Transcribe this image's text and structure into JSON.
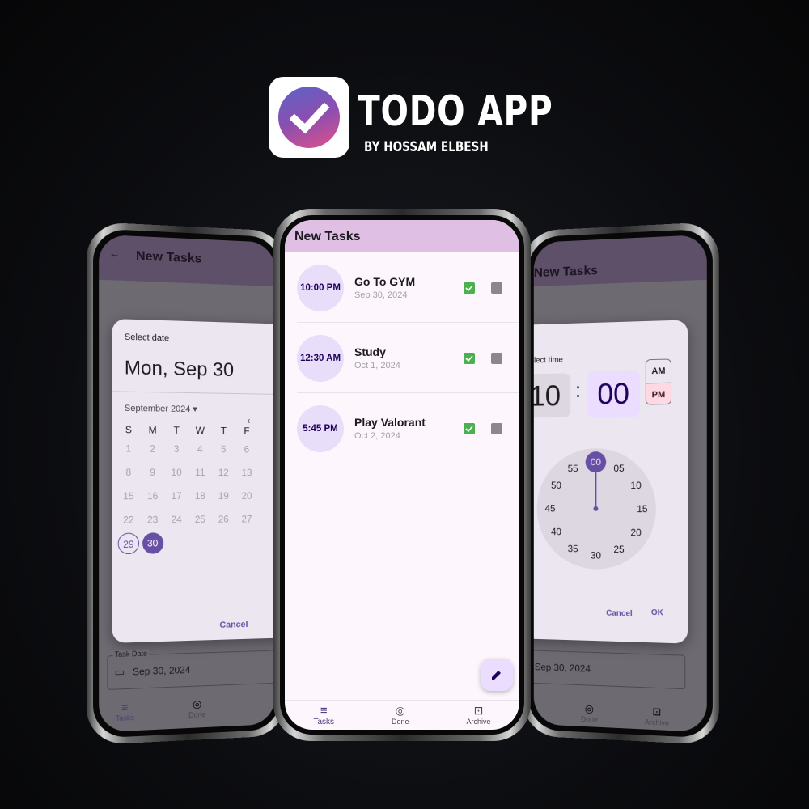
{
  "brand": {
    "title": "TODO APP",
    "subtitle": "BY HOSSAM ELBESH",
    "accent": "#6750a4"
  },
  "app": {
    "header_title": "New Tasks"
  },
  "tasks": [
    {
      "time": "10:00 PM",
      "title": "Go To GYM",
      "date": "Sep 30, 2024"
    },
    {
      "time": "12:30 AM",
      "title": "Study",
      "date": "Oct 1, 2024"
    },
    {
      "time": "5:45 PM",
      "title": "Play Valorant",
      "date": "Oct 2, 2024"
    }
  ],
  "nav": {
    "tasks": "Tasks",
    "done": "Done",
    "archive": "Archive"
  },
  "date_picker": {
    "label": "Select date",
    "headline": "Mon, Sep 30",
    "month": "September 2024",
    "weekdays": [
      "S",
      "M",
      "T",
      "W",
      "T",
      "F"
    ],
    "weeks": [
      [
        "1",
        "2",
        "3",
        "4",
        "5",
        "6"
      ],
      [
        "8",
        "9",
        "10",
        "11",
        "12",
        "13"
      ],
      [
        "15",
        "16",
        "17",
        "18",
        "19",
        "20"
      ],
      [
        "22",
        "23",
        "24",
        "25",
        "26",
        "27"
      ],
      [
        "29",
        "30"
      ]
    ],
    "today": "29",
    "selected": "30",
    "cancel": "Cancel"
  },
  "time_picker": {
    "label": "Select time",
    "hour": "10",
    "separator": ":",
    "minute": "00",
    "am": "AM",
    "pm": "PM",
    "period_selected": "PM",
    "dial": [
      "00",
      "05",
      "10",
      "15",
      "20",
      "25",
      "30",
      "35",
      "40",
      "45",
      "50",
      "55"
    ],
    "cancel": "Cancel",
    "ok": "OK"
  },
  "task_date_field": {
    "label": "Task Date",
    "value": "Sep 30, 2024"
  }
}
